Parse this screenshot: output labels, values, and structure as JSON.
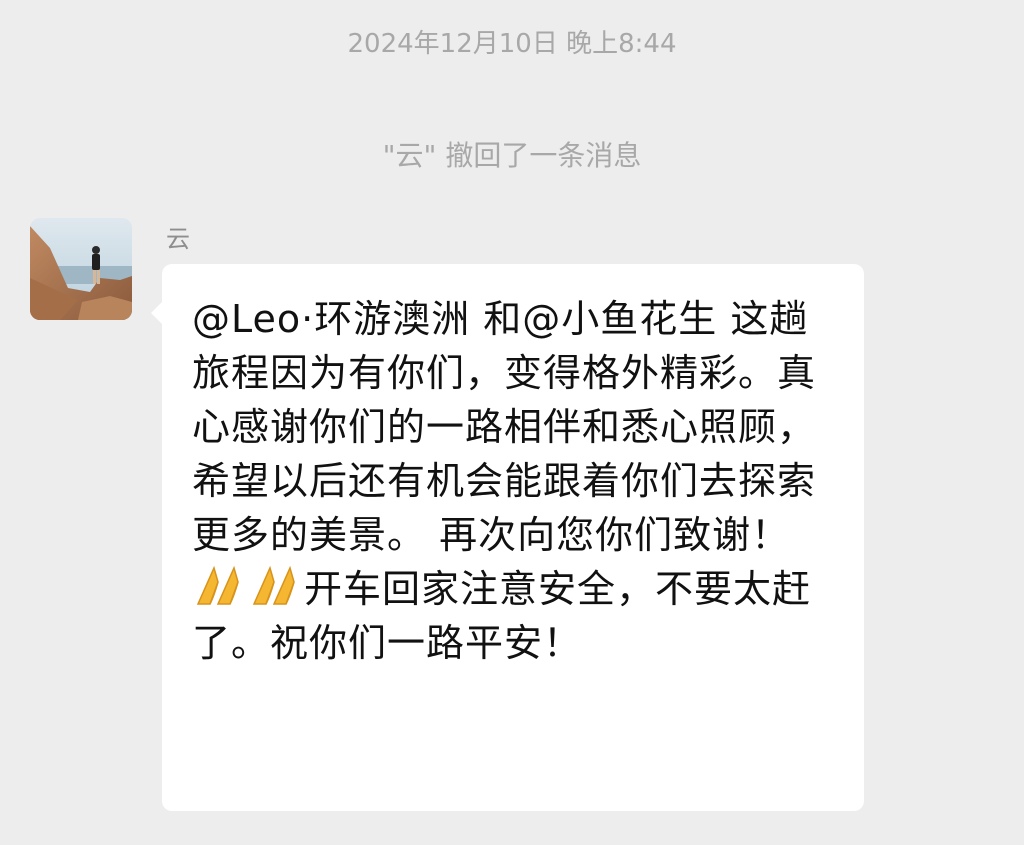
{
  "chat": {
    "timestamp": "2024年12月10日 晚上8:44",
    "recall_notice": "\"云\" 撤回了一条消息"
  },
  "message": {
    "sender": "云",
    "avatar_icon": "avatar-photo",
    "part1": "@Leo·环游澳洲  和@小鱼花生  这趟旅程因为有你们，变得格外精彩。真心感谢你们的一路相伴和悉心照顾，希望以后还有机会能跟着你们去探索更多的美景。 再次向您你们致谢！ ",
    "emoji": "pray-emoji",
    "part2": "开车回家注意安全，不要太赶了。祝你们一路平安！"
  },
  "colors": {
    "background": "#ededed",
    "bubble": "#ffffff",
    "meta_text": "#a8a8a8",
    "emoji": "#f5b731"
  }
}
